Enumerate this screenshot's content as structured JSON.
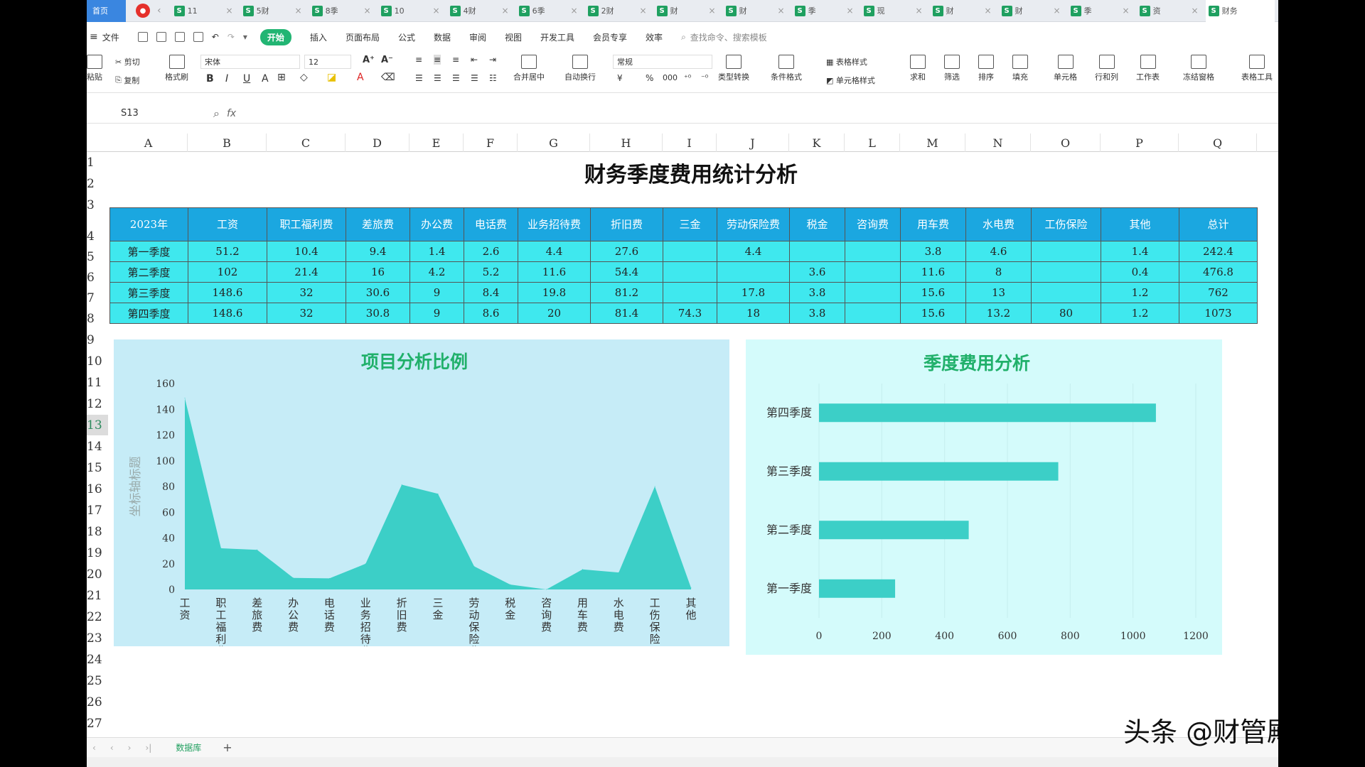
{
  "tabbar": {
    "home": "首页",
    "file_tabs": [
      "11",
      "5财",
      "8季",
      "10",
      "4财",
      "6季",
      "2财",
      "财",
      "财",
      "季",
      "现",
      "财",
      "财",
      "季",
      "资",
      "财务"
    ]
  },
  "menubar": {
    "file": "文件",
    "start": "开始",
    "items": [
      "插入",
      "页面布局",
      "公式",
      "数据",
      "审阅",
      "视图",
      "开发工具",
      "会员专享",
      "效率"
    ],
    "search": "查找命令、搜索模板"
  },
  "ribbon": {
    "paste": "粘贴",
    "cut": "剪切",
    "copy": "复制",
    "format_painter": "格式刷",
    "font": "宋体",
    "size": "12",
    "merge": "合并居中",
    "wrap": "自动换行",
    "number_format": "常规",
    "type_convert": "类型转换",
    "cond_format": "条件格式",
    "table_style": "表格样式",
    "cell_style": "单元格样式",
    "sum": "求和",
    "filter": "筛选",
    "sort": "排序",
    "fill": "填充",
    "cell": "单元格",
    "rowcol": "行和列",
    "sheet": "工作表",
    "freeze": "冻结窗格",
    "tools": "表格工具"
  },
  "formulabar": {
    "namebox": "S13",
    "fx": "fx"
  },
  "columns": [
    "A",
    "B",
    "C",
    "D",
    "E",
    "F",
    "G",
    "H",
    "I",
    "J",
    "K",
    "L",
    "M",
    "N",
    "O",
    "P",
    "Q"
  ],
  "rows": [
    "1",
    "2",
    "3",
    "4",
    "5",
    "6",
    "7",
    "8",
    "9",
    "10",
    "11",
    "12",
    "13",
    "14",
    "15",
    "16",
    "17",
    "18",
    "19",
    "20",
    "21",
    "22",
    "23",
    "24",
    "25",
    "26",
    "27"
  ],
  "sheet_title": "财务季度费用统计分析",
  "table": {
    "headers": [
      "2023年",
      "工资",
      "职工福利费",
      "差旅费",
      "办公费",
      "电话费",
      "业务招待费",
      "折旧费",
      "三金",
      "劳动保险费",
      "税金",
      "咨询费",
      "用车费",
      "水电费",
      "工伤保险",
      "其他",
      "总计"
    ],
    "rows": [
      [
        "第一季度",
        "51.2",
        "10.4",
        "9.4",
        "1.4",
        "2.6",
        "4.4",
        "27.6",
        "",
        "4.4",
        "",
        "",
        "3.8",
        "4.6",
        "",
        "1.4",
        "242.4"
      ],
      [
        "第二季度",
        "102",
        "21.4",
        "16",
        "4.2",
        "5.2",
        "11.6",
        "54.4",
        "",
        "",
        "3.6",
        "",
        "11.6",
        "8",
        "",
        "0.4",
        "476.8"
      ],
      [
        "第三季度",
        "148.6",
        "32",
        "30.6",
        "9",
        "8.4",
        "19.8",
        "81.2",
        "",
        "17.8",
        "3.8",
        "",
        "15.6",
        "13",
        "",
        "1.2",
        "762"
      ],
      [
        "第四季度",
        "148.6",
        "32",
        "30.8",
        "9",
        "8.6",
        "20",
        "81.4",
        "74.3",
        "18",
        "3.8",
        "",
        "15.6",
        "13.2",
        "80",
        "1.2",
        "1073"
      ]
    ]
  },
  "chart_data": [
    {
      "type": "area",
      "title": "项目分析比例",
      "ylabel": "坐标轴标题",
      "categories": [
        "工资",
        "职工福利费",
        "差旅费",
        "办公费",
        "电话费",
        "业务招待费",
        "折旧费",
        "三金",
        "劳动保险费",
        "税金",
        "咨询费",
        "用车费",
        "水电费",
        "工伤保险",
        "其他"
      ],
      "values": [
        148.6,
        32,
        30.8,
        9,
        8.6,
        20,
        81.4,
        74.3,
        18,
        3.8,
        0,
        15.6,
        13.2,
        80,
        1.2
      ],
      "ylim": [
        0,
        160
      ],
      "yticks": [
        0,
        20,
        40,
        60,
        80,
        100,
        120,
        140,
        160
      ],
      "color": "#3ccfc7"
    },
    {
      "type": "bar",
      "orientation": "horizontal",
      "title": "季度费用分析",
      "categories": [
        "第一季度",
        "第二季度",
        "第三季度",
        "第四季度"
      ],
      "values": [
        242.4,
        476.8,
        762,
        1073
      ],
      "xlim": [
        0,
        1200
      ],
      "xticks": [
        0,
        200,
        400,
        600,
        800,
        1000,
        1200
      ],
      "color": "#3ccfc7"
    }
  ],
  "sheetbar": {
    "sheet_name": "数据库",
    "add": "+"
  },
  "watermark": "头条 @财管殿堂"
}
